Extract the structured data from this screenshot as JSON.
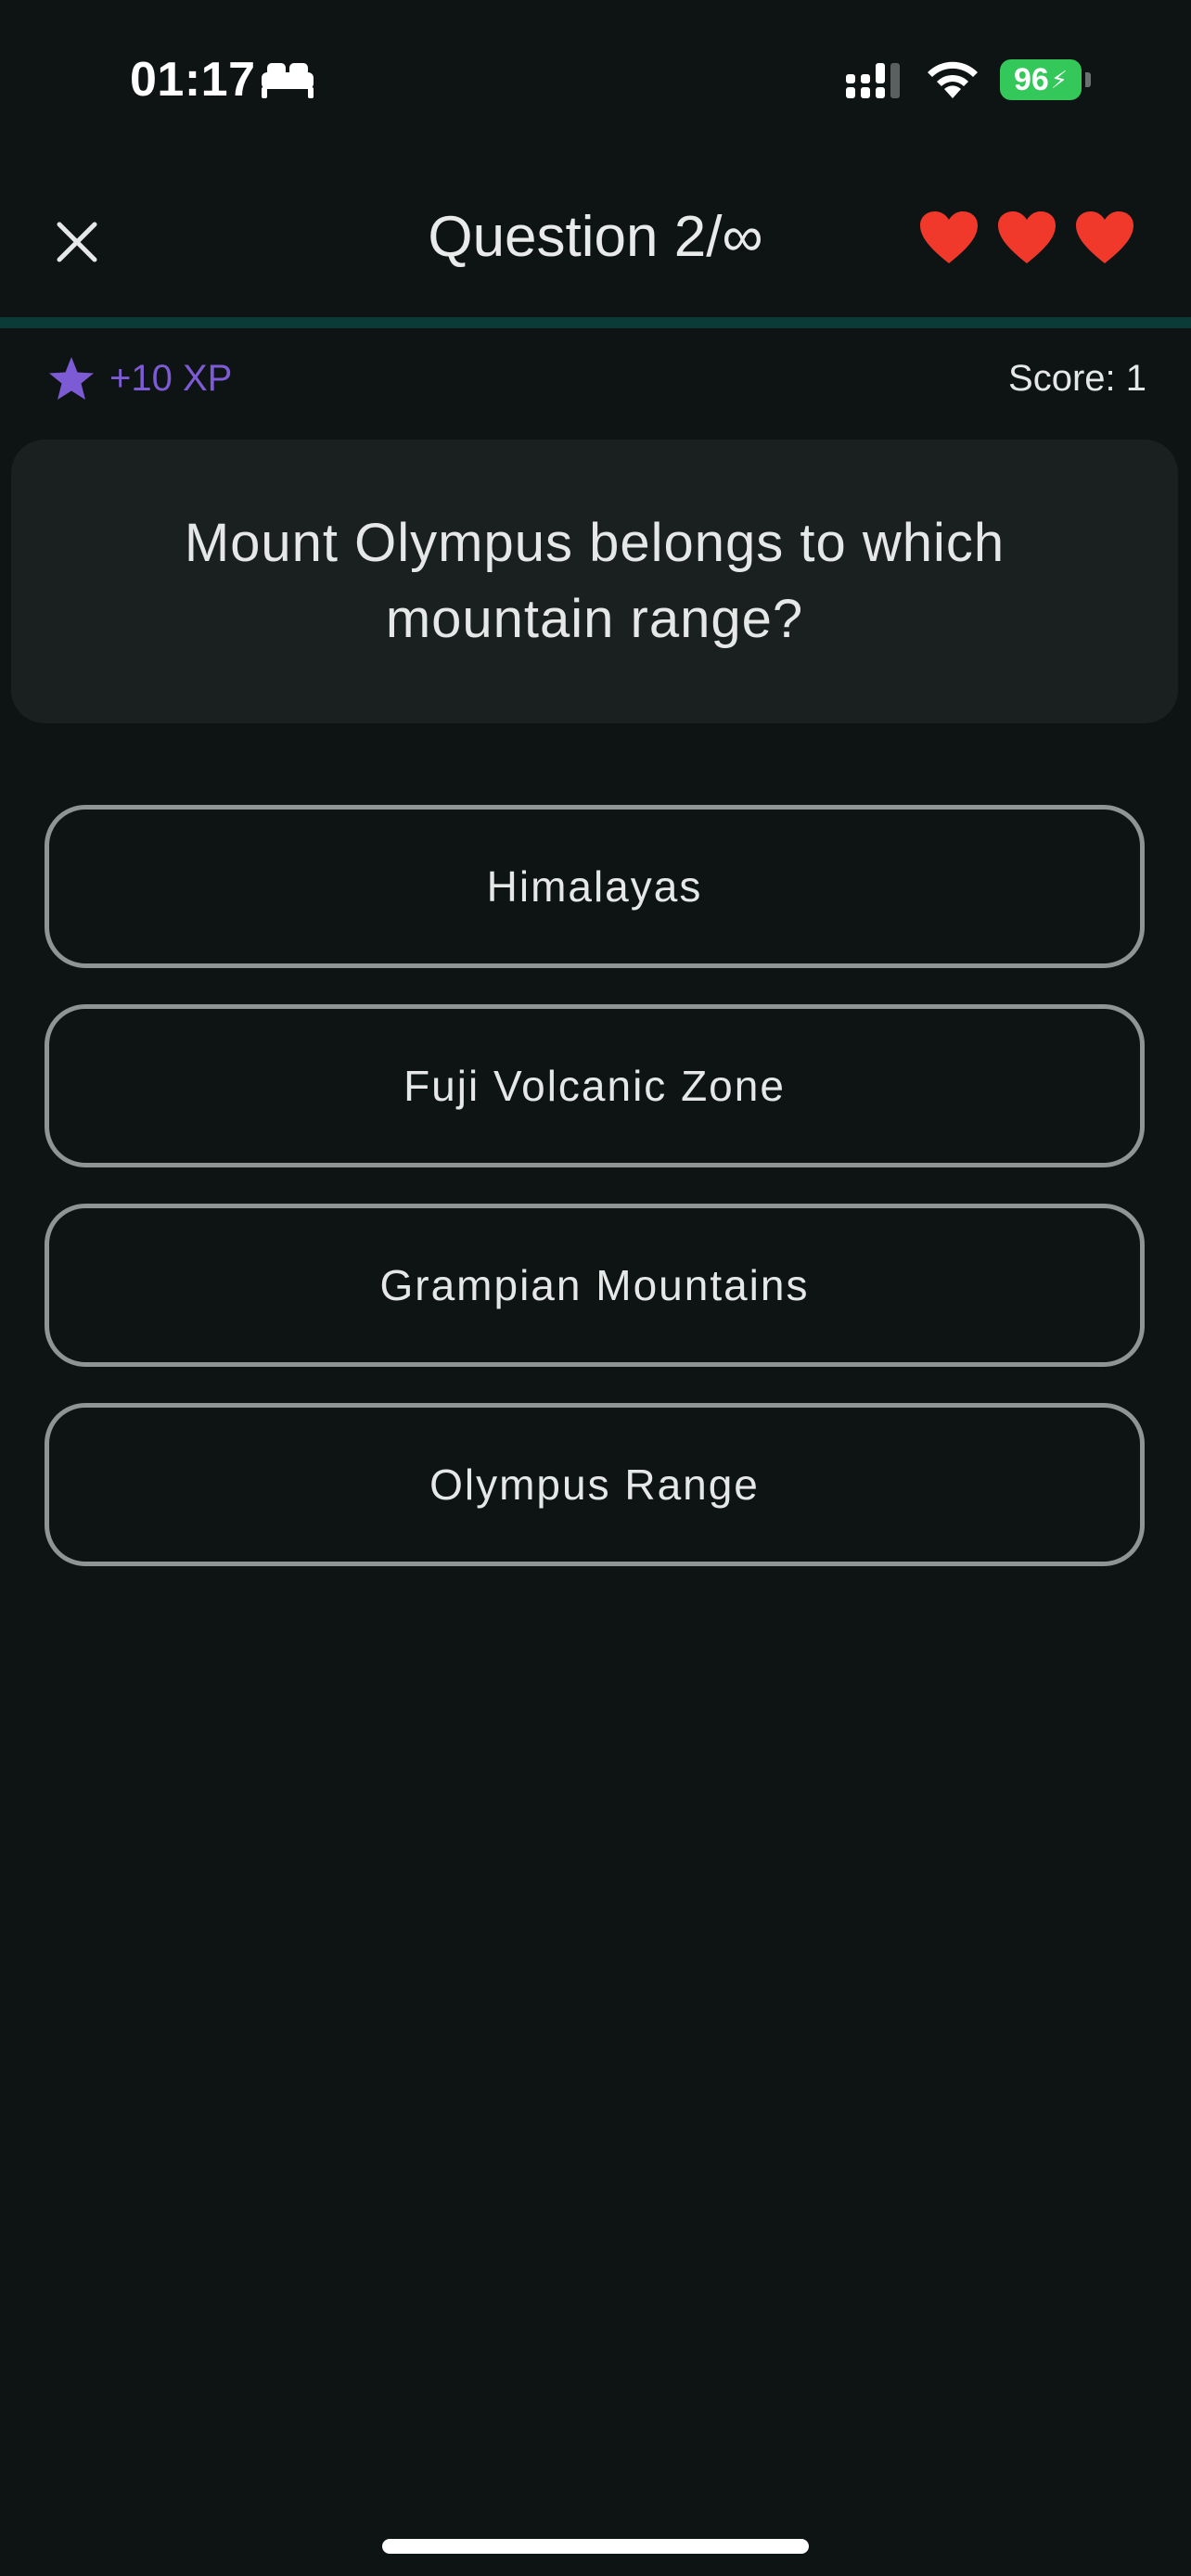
{
  "status_bar": {
    "time": "01:17",
    "battery_percent": "96",
    "icons": [
      "bed-icon",
      "cellular-signal-icon",
      "wifi-icon",
      "battery-charging-icon"
    ]
  },
  "header": {
    "title": "Question 2/∞",
    "close_icon": "close-icon",
    "lives": 3,
    "heart_color": "#f0392b"
  },
  "progress": {
    "fraction": 0.0,
    "track_color": "#0b3b36"
  },
  "xp": {
    "label": "+10 XP",
    "color": "#7d5bd4",
    "icon": "star-icon"
  },
  "score": {
    "label": "Score: 1"
  },
  "question": {
    "text": "Mount Olympus belongs to which mountain range?"
  },
  "answers": [
    {
      "label": "Himalayas"
    },
    {
      "label": "Fuji Volcanic Zone"
    },
    {
      "label": "Grampian Mountains"
    },
    {
      "label": "Olympus Range"
    }
  ]
}
